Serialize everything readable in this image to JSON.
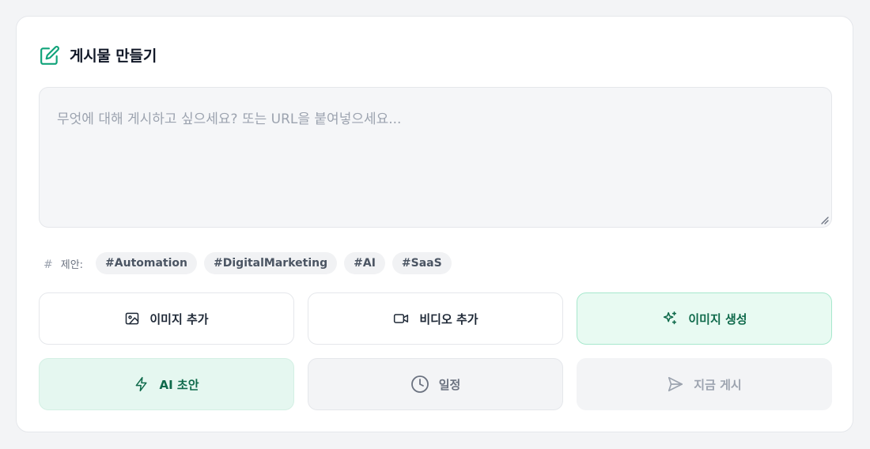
{
  "header": {
    "title": "게시물 만들기",
    "icon": "edit-icon"
  },
  "compose": {
    "value": "",
    "placeholder": "무엇에 대해 게시하고 싶으세요? 또는 URL을 붙여넣으세요..."
  },
  "suggestions": {
    "hash_symbol": "#",
    "label": "제안:",
    "tags": [
      "#Automation",
      "#DigitalMarketing",
      "#AI",
      "#SaaS"
    ]
  },
  "actions": {
    "add_image": {
      "label": "이미지 추가",
      "icon": "image-icon"
    },
    "add_video": {
      "label": "비디오 추가",
      "icon": "video-icon"
    },
    "generate_image": {
      "label": "이미지 생성",
      "icon": "sparkles-icon"
    },
    "ai_draft": {
      "label": "AI 초안",
      "icon": "lightning-icon"
    },
    "schedule": {
      "label": "일정",
      "icon": "clock-icon"
    },
    "post_now": {
      "label": "지금 게시",
      "icon": "send-icon"
    }
  },
  "colors": {
    "accent": "#10b981",
    "accent_dark": "#0f6a4b",
    "accent_bg": "#e8faf2",
    "border": "#e5e7eb",
    "muted_text": "#9ca3af"
  }
}
